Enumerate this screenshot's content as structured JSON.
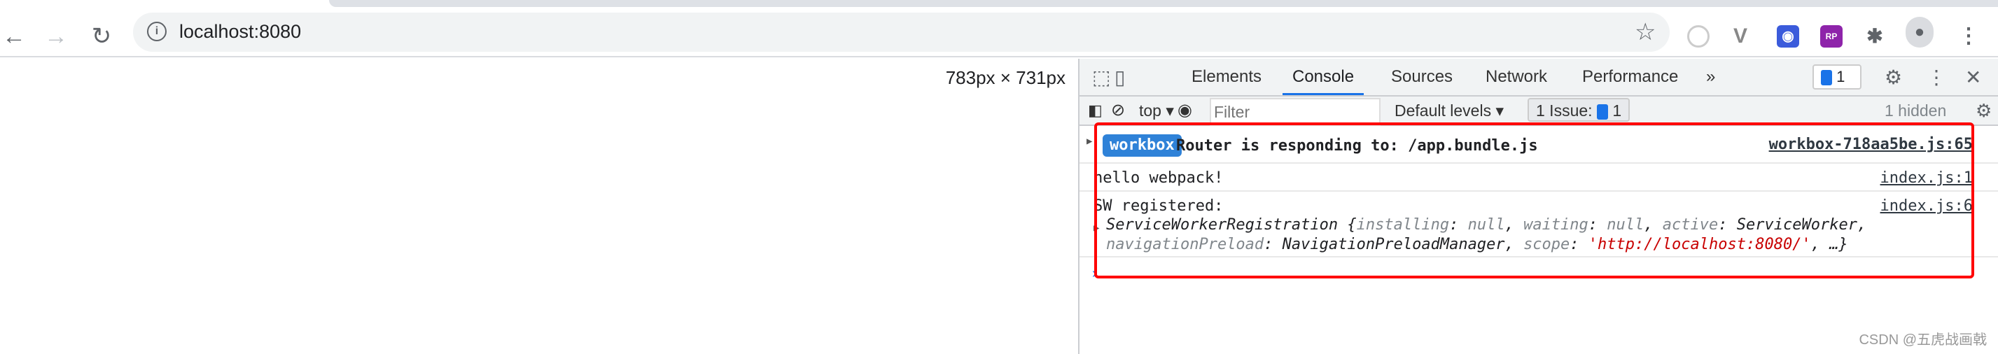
{
  "browser": {
    "url": "localhost:8080",
    "back": "←",
    "forward": "→",
    "reload": "↻"
  },
  "page": {
    "viewport_dims": "783px × 731px"
  },
  "devtools": {
    "tabs": [
      {
        "label": "Elements"
      },
      {
        "label": "Console",
        "active": true
      },
      {
        "label": "Sources"
      },
      {
        "label": "Network"
      },
      {
        "label": "Performance"
      }
    ],
    "more_tabs": "»",
    "issues_badge_count": "1",
    "console_toolbar": {
      "context": "top",
      "filter_placeholder": "Filter",
      "levels": "Default levels",
      "issues_label": "1 Issue:",
      "issues_count": "1",
      "hidden": "1 hidden"
    },
    "messages": [
      {
        "badge": "workbox",
        "text": "Router is responding to: /app.bundle.js",
        "source": "workbox-718aa5be.js:65"
      },
      {
        "text": "hello webpack!",
        "source": "index.js:1"
      },
      {
        "text": "SW registered:",
        "source": "index.js:6",
        "object": {
          "name": "ServiceWorkerRegistration",
          "k1": "installing",
          "v1": "null",
          "k2": "waiting",
          "v2": "null",
          "k3": "active",
          "v3": "ServiceWorker",
          "k4": "navigationPreload",
          "v4": "NavigationPreloadManager",
          "k5": "scope",
          "v5": "'http://localhost:8080/'",
          "ellipsis": "…}"
        }
      }
    ],
    "accent": "#1a73e8",
    "highlight_box": "#ff0000"
  },
  "watermark": "CSDN @五虎战画戟"
}
